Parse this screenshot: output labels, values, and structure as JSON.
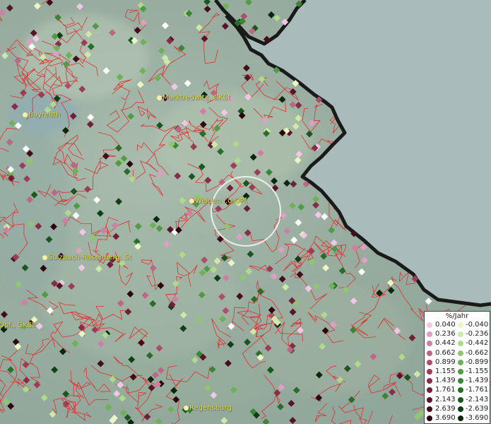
{
  "map": {
    "cities": [
      {
        "name": "Bayreuth"
      },
      {
        "name": "Marktredwitz, GKSt"
      },
      {
        "name": "Weiden i.d.OPf."
      },
      {
        "name": "Sulzbach-Rosenberg, St"
      },
      {
        "name": "Opf., GKSt"
      },
      {
        "name": "Regensburg"
      }
    ],
    "colors": {
      "border_lines": "#e03030",
      "country_border": "#1a1a1a",
      "foreign_area": "#a9bbbb",
      "city_label": "#e3e03a"
    }
  },
  "legend": {
    "title": "%/Jahr",
    "positive": [
      {
        "label": "0.040",
        "color": "#f1c6e6"
      },
      {
        "label": "0.236",
        "color": "#df9fc4"
      },
      {
        "label": "0.442",
        "color": "#cf7fa4"
      },
      {
        "label": "0.662",
        "color": "#be6685"
      },
      {
        "label": "0.899",
        "color": "#ad4f6c"
      },
      {
        "label": "1.155",
        "color": "#9b3d58"
      },
      {
        "label": "1.439",
        "color": "#872d45"
      },
      {
        "label": "1.761",
        "color": "#702036"
      },
      {
        "label": "2.143",
        "color": "#5a1428"
      },
      {
        "label": "2.639",
        "color": "#440c1b"
      },
      {
        "label": "3.690",
        "color": "#2c050f"
      }
    ],
    "negative": [
      {
        "label": "-0.040",
        "color": "#eaf6c4"
      },
      {
        "label": "-0.236",
        "color": "#cde9a8"
      },
      {
        "label": "-0.442",
        "color": "#afd98b"
      },
      {
        "label": "-0.662",
        "color": "#8fc670"
      },
      {
        "label": "-0.899",
        "color": "#6fb05a"
      },
      {
        "label": "-1.155",
        "color": "#539a46"
      },
      {
        "label": "-1.439",
        "color": "#3c8436"
      },
      {
        "label": "-1.761",
        "color": "#2a6d29"
      },
      {
        "label": "-2.143",
        "color": "#1b561e"
      },
      {
        "label": "-2.639",
        "color": "#0f3f14"
      },
      {
        "label": "-3.690",
        "color": "#06280b"
      }
    ]
  }
}
